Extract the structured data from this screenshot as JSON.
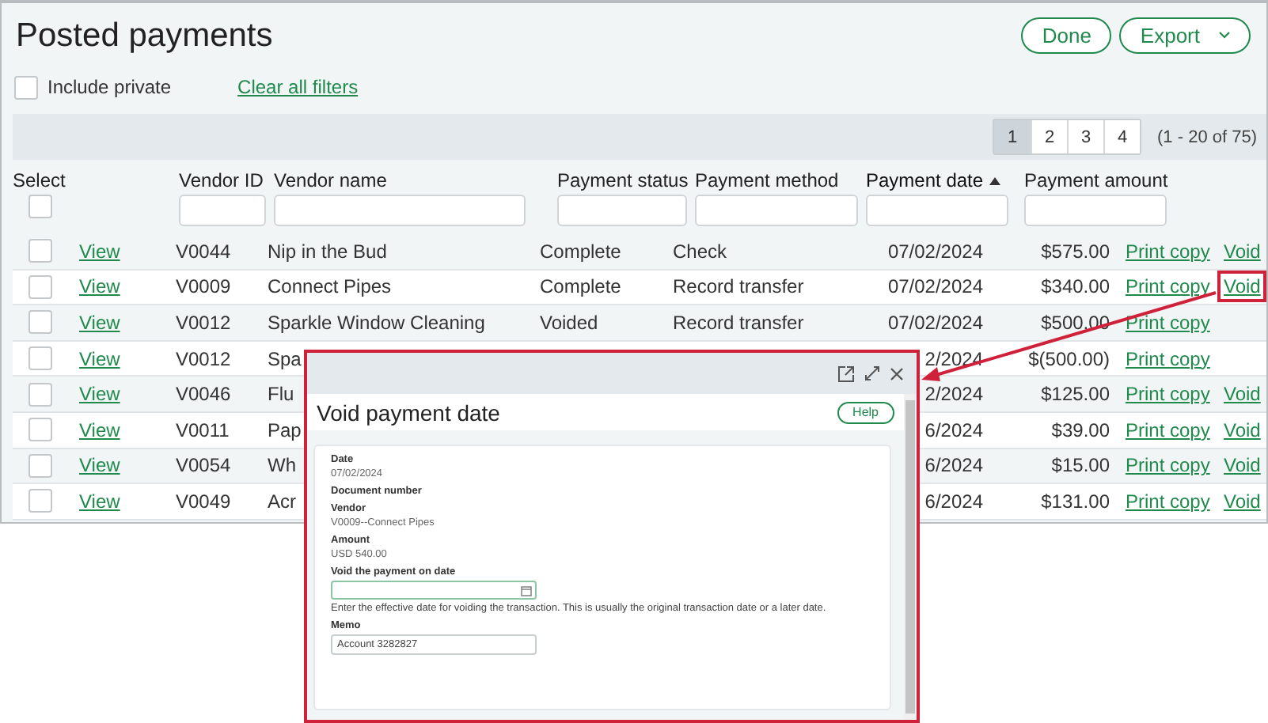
{
  "title": "Posted payments",
  "header_buttons": [
    {
      "label": "Done",
      "kind": "plain"
    },
    {
      "label": "Export",
      "kind": "menu"
    }
  ],
  "filters": {
    "include_private": {
      "label": "Include private",
      "checked": false
    },
    "clear_link": "Clear all filters"
  },
  "pagination": {
    "pages": [
      {
        "label": "1",
        "selected": true
      },
      {
        "label": "2",
        "selected": false
      },
      {
        "label": "3",
        "selected": false
      },
      {
        "label": "4",
        "selected": false
      }
    ],
    "range": "(1 - 20 of 75)"
  },
  "table": {
    "select_label": "Select",
    "select_all_checked": false,
    "columns": [
      {
        "label": "Vendor ID",
        "sorted": false
      },
      {
        "label": "Vendor name",
        "sorted": false
      },
      {
        "label": "Payment status",
        "sorted": false
      },
      {
        "label": "Payment method",
        "sorted": false
      },
      {
        "label": "Payment date",
        "sorted": true
      },
      {
        "label": "Payment amount",
        "sorted": false
      }
    ],
    "rows": [
      {
        "checked": false,
        "view": "View",
        "vendor_id": "V0044",
        "vendor_name": "Nip in the Bud",
        "status": "Complete",
        "method": "Check",
        "date": "07/02/2024",
        "amount": "$575.00",
        "print": "Print copy",
        "void": "Void",
        "void_highlighted": false
      },
      {
        "checked": false,
        "view": "View",
        "vendor_id": "V0009",
        "vendor_name": "Connect Pipes",
        "status": "Complete",
        "method": "Record transfer",
        "date": "07/02/2024",
        "amount": "$340.00",
        "print": "Print copy",
        "void": "Void",
        "void_highlighted": true
      },
      {
        "checked": false,
        "view": "View",
        "vendor_id": "V0012",
        "vendor_name": "Sparkle Window Cleaning",
        "status": "Voided",
        "method": "Record transfer",
        "date": "07/02/2024",
        "amount": "$500.00",
        "print": "Print copy"
      },
      {
        "checked": false,
        "view": "View",
        "vendor_id": "V0012",
        "vendor_name": "Spa",
        "date": "2/2024",
        "amount": "$(500.00)",
        "print": "Print copy"
      },
      {
        "checked": false,
        "view": "View",
        "vendor_id": "V0046",
        "vendor_name": "Flu",
        "date": "2/2024",
        "amount": "$125.00",
        "print": "Print copy",
        "void": "Void",
        "void_highlighted": false
      },
      {
        "checked": false,
        "view": "View",
        "vendor_id": "V0011",
        "vendor_name": "Pap",
        "date": "6/2024",
        "amount": "$39.00",
        "print": "Print copy",
        "void": "Void",
        "void_highlighted": false
      },
      {
        "checked": false,
        "view": "View",
        "vendor_id": "V0054",
        "vendor_name": "Wh",
        "date": "6/2024",
        "amount": "$15.00",
        "print": "Print copy",
        "void": "Void",
        "void_highlighted": false
      },
      {
        "checked": false,
        "view": "View",
        "vendor_id": "V0049",
        "vendor_name": "Acr",
        "date": "6/2024",
        "amount": "$131.00",
        "print": "Print copy",
        "void": "Void",
        "void_highlighted": false
      }
    ]
  },
  "dialog": {
    "title": "Void payment date",
    "help": "Help",
    "fields": [
      {
        "kind": "text",
        "label": "Date",
        "value": "07/02/2024"
      },
      {
        "kind": "text",
        "label": "Document number"
      },
      {
        "kind": "text",
        "label": "Vendor",
        "value": "V0009--Connect Pipes"
      },
      {
        "kind": "text",
        "label": "Amount",
        "value": "USD 540.00"
      },
      {
        "kind": "date",
        "label": "Void the payment on date",
        "hint": "Enter the effective date for voiding the transaction. This is usually the original transaction date or a later date."
      },
      {
        "kind": "textarea",
        "label": "Memo",
        "value": "Account 3282827"
      }
    ]
  }
}
